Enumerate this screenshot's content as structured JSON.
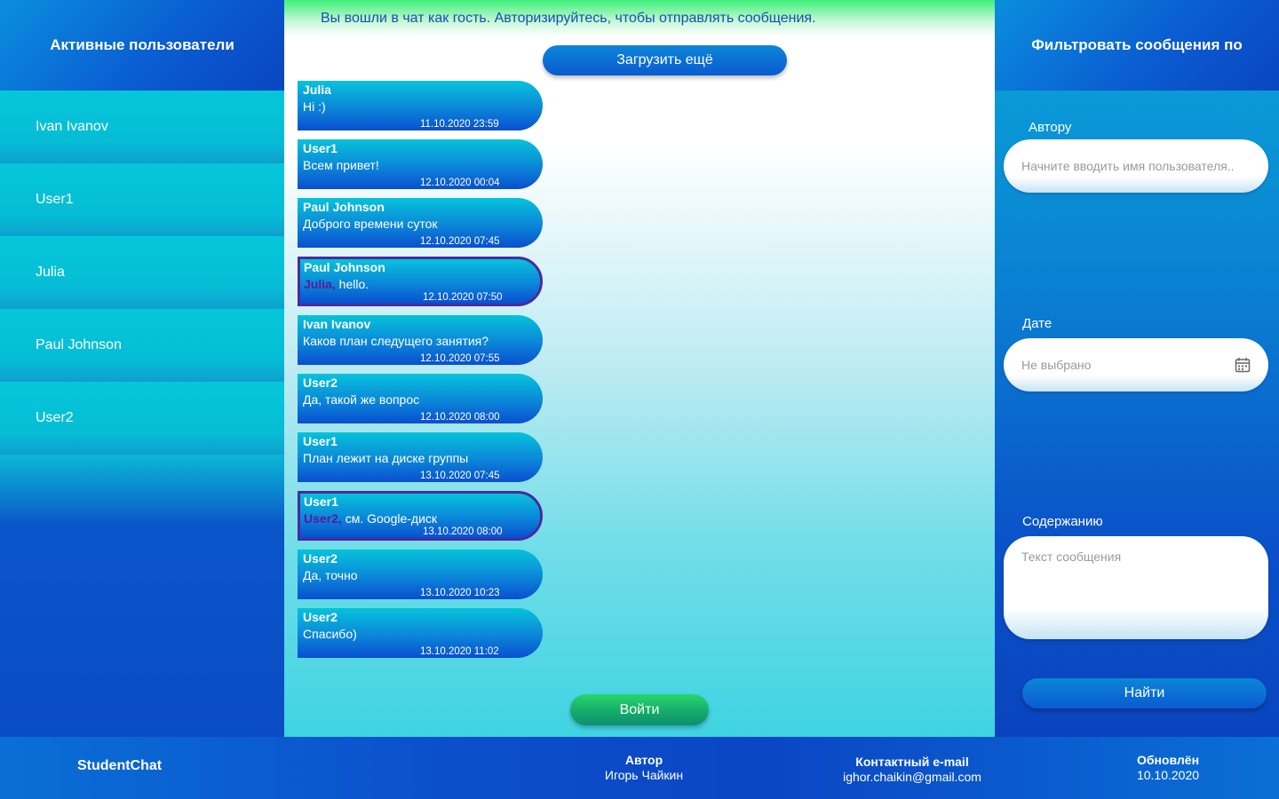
{
  "left_panel": {
    "title": "Активные пользователи",
    "users": [
      "Ivan Ivanov",
      "User1",
      "Julia",
      "Paul Johnson",
      "User2"
    ]
  },
  "chat": {
    "notice": "Вы вошли в чат как гость. Авторизируйтесь, чтобы отправлять сообщения.",
    "load_more_label": "Загрузить ещё",
    "login_label": "Войти",
    "messages": [
      {
        "author": "Julia",
        "mention": "",
        "text": "Hi :)",
        "time": "11.10.2020 23:59"
      },
      {
        "author": "User1",
        "mention": "",
        "text": "Всем привет!",
        "time": "12.10.2020 00:04"
      },
      {
        "author": "Paul Johnson",
        "mention": "",
        "text": "Доброго времени суток",
        "time": "12.10.2020 07:45"
      },
      {
        "author": "Paul Johnson",
        "mention": "Julia,",
        "text": " hello.",
        "time": "12.10.2020 07:50"
      },
      {
        "author": "Ivan Ivanov",
        "mention": "",
        "text": "Каков план следущего занятия?",
        "time": "12.10.2020 07:55"
      },
      {
        "author": "User2",
        "mention": "",
        "text": "Да, такой же вопрос",
        "time": "12.10.2020 08:00"
      },
      {
        "author": "User1",
        "mention": "",
        "text": "План лежит на диске группы",
        "time": "13.10.2020 07:45"
      },
      {
        "author": "User1",
        "mention": "User2,",
        "text": " см. Google-диск",
        "time": "13.10.2020 08:00"
      },
      {
        "author": "User2",
        "mention": "",
        "text": "Да, точно",
        "time": "13.10.2020 10:23"
      },
      {
        "author": "User2",
        "mention": "",
        "text": "Спасибо)",
        "time": "13.10.2020 11:02"
      }
    ]
  },
  "filter_panel": {
    "title": "Фильтровать сообщения по",
    "author_label": "Автору",
    "author_placeholder": "Начните вводить имя пользователя..",
    "date_label": "Дате",
    "date_value": "Не выбрано",
    "content_label": "Содержанию",
    "content_placeholder": "Текст сообщения",
    "find_label": "Найти"
  },
  "footer": {
    "brand": "StudentChat",
    "author_title": "Автор",
    "author_value": "Игорь Чайкин",
    "email_title": "Контактный e-mail",
    "email_value": "ighor.chaikin@gmail.com",
    "updated_title": "Обновлён",
    "updated_value": "10.10.2020"
  },
  "colors": {
    "mention_border": "#4a2aa0",
    "mention_text": "#5a1a9a",
    "login_green": "#14a96a"
  }
}
